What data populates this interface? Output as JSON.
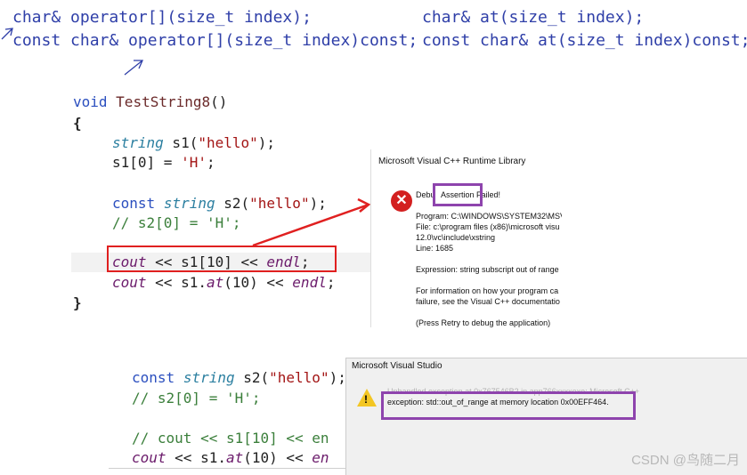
{
  "notes": {
    "line1_left": "char& operator[](size_t index);",
    "line2_left": "const char& operator[](size_t index)const;",
    "line1_right": "char& at(size_t index);",
    "line2_right": "const char& at(size_t index)const;"
  },
  "code_top": {
    "l1_kw": "void",
    "l1_fn": "TestString8",
    "l1_rest": "()",
    "l2": "{",
    "l3_ty": "string",
    "l3_rest": " s1(",
    "l3_str": "\"hello\"",
    "l3_end": ");",
    "l4_a": "s1[0] = ",
    "l4_str": "'H'",
    "l4_end": ";",
    "l5_kw": "const",
    "l5_ty": "string",
    "l5_rest": " s2(",
    "l5_str": "\"hello\"",
    "l5_end": ");",
    "l6": "// s2[0] = 'H';",
    "l7_a": "cout",
    "l7_b": " << s1[10] << ",
    "l7_c": "endl",
    "l7_d": ";",
    "l8_a": "cout",
    "l8_b": " << s1.",
    "l8_c": "at",
    "l8_d": "(10) << ",
    "l8_e": "endl",
    "l8_f": ";",
    "l9": "}"
  },
  "dialog1": {
    "title": "Microsoft Visual C++ Runtime Library",
    "debug_prefix": "Debu",
    "assertion": "Assertion Failed!",
    "program": "Program: C:\\WINDOWS\\SYSTEM32\\MSVC",
    "file": "File: c:\\program files (x86)\\microsoft visu",
    "file2": "12.0\\vc\\include\\xstring",
    "line": "Line: 1685",
    "expression": "Expression: string subscript out of range",
    "info1": "For information on how your program ca",
    "info2": "failure, see the Visual C++ documentatio",
    "retry": "(Press Retry to debug the application)"
  },
  "code_bottom": {
    "l1_kw": "const",
    "l1_ty": "string",
    "l1_rest": " s2(",
    "l1_str": "\"hello\"",
    "l1_end": ");",
    "l2": "// s2[0] = 'H';",
    "l3": "// cout << s1[10] << en",
    "l4_a": "cout",
    "l4_b": " << s1.",
    "l4_c": "at",
    "l4_d": "(10) << ",
    "l4_e": "en"
  },
  "dialog2": {
    "title": "Microsoft Visual Studio",
    "line1": "Unhandled exception at 0x767546B2 in app766xxxxexe: Microsoft C++",
    "line2": "exception: std::out_of_range at memory location 0x00EFF464."
  },
  "watermark": "CSDN @鸟随二月"
}
